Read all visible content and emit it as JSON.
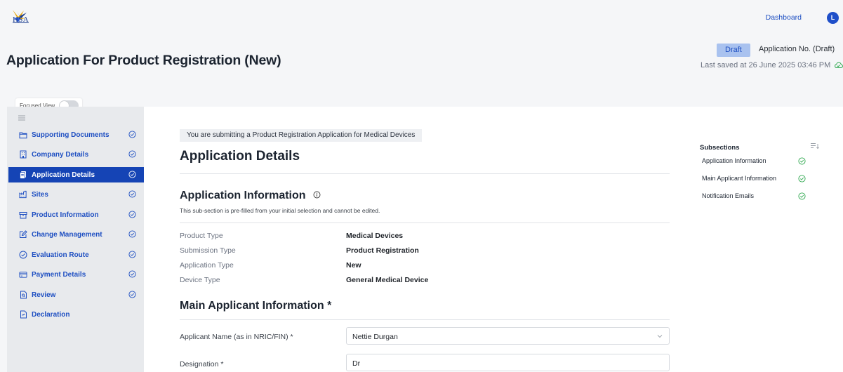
{
  "header": {
    "logo_text": "HSA",
    "dashboard_link": "Dashboard",
    "avatar_initial": "L"
  },
  "page": {
    "title": "Application For Product Registration (New)",
    "status_badge": "Draft",
    "application_no": "Application No. (Draft)",
    "last_saved": "Last saved at 26 June 2025 03:46 PM",
    "focused_view_label": "Focused View",
    "focused_view_on": false
  },
  "sidebar": {
    "items": [
      {
        "label": "Supporting Documents",
        "icon": "folder-icon",
        "completed": true,
        "active": false
      },
      {
        "label": "Company Details",
        "icon": "building-icon",
        "completed": true,
        "active": false
      },
      {
        "label": "Application Details",
        "icon": "document-stack-icon",
        "completed": true,
        "active": true
      },
      {
        "label": "Sites",
        "icon": "factory-icon",
        "completed": true,
        "active": false
      },
      {
        "label": "Product Information",
        "icon": "box-icon",
        "completed": true,
        "active": false
      },
      {
        "label": "Change Management",
        "icon": "edit-icon",
        "completed": true,
        "active": false
      },
      {
        "label": "Evaluation Route",
        "icon": "check-circle-icon",
        "completed": true,
        "active": false
      },
      {
        "label": "Payment Details",
        "icon": "credit-card-icon",
        "completed": true,
        "active": false
      },
      {
        "label": "Review",
        "icon": "review-doc-icon",
        "completed": true,
        "active": false
      },
      {
        "label": "Declaration",
        "icon": "declaration-doc-icon",
        "completed": false,
        "active": false
      }
    ]
  },
  "main": {
    "notice": "You are submitting a Product Registration Application for Medical Devices",
    "heading": "Application Details",
    "app_info": {
      "title": "Application Information",
      "note": "This sub-section is pre-filled from your initial selection and cannot be edited.",
      "rows": [
        {
          "label": "Product Type",
          "value": "Medical Devices"
        },
        {
          "label": "Submission Type",
          "value": "Product Registration"
        },
        {
          "label": "Application Type",
          "value": "New"
        },
        {
          "label": "Device Type",
          "value": "General Medical Device"
        }
      ]
    },
    "main_applicant": {
      "title": "Main Applicant Information *",
      "applicant_name_label": "Applicant Name (as in NRIC/FIN) *",
      "applicant_name_value": "Nettie Durgan",
      "designation_label": "Designation *",
      "designation_value": "Dr"
    }
  },
  "subsections": {
    "title": "Subsections",
    "items": [
      {
        "label": "Application Information",
        "completed": true
      },
      {
        "label": "Main Applicant Information",
        "completed": true
      },
      {
        "label": "Notification Emails",
        "completed": true
      }
    ]
  },
  "colors": {
    "accent": "#1544b5",
    "link": "#1e4fc2",
    "success": "#2fa84f",
    "draft_badge_bg": "#a9c2ef"
  }
}
